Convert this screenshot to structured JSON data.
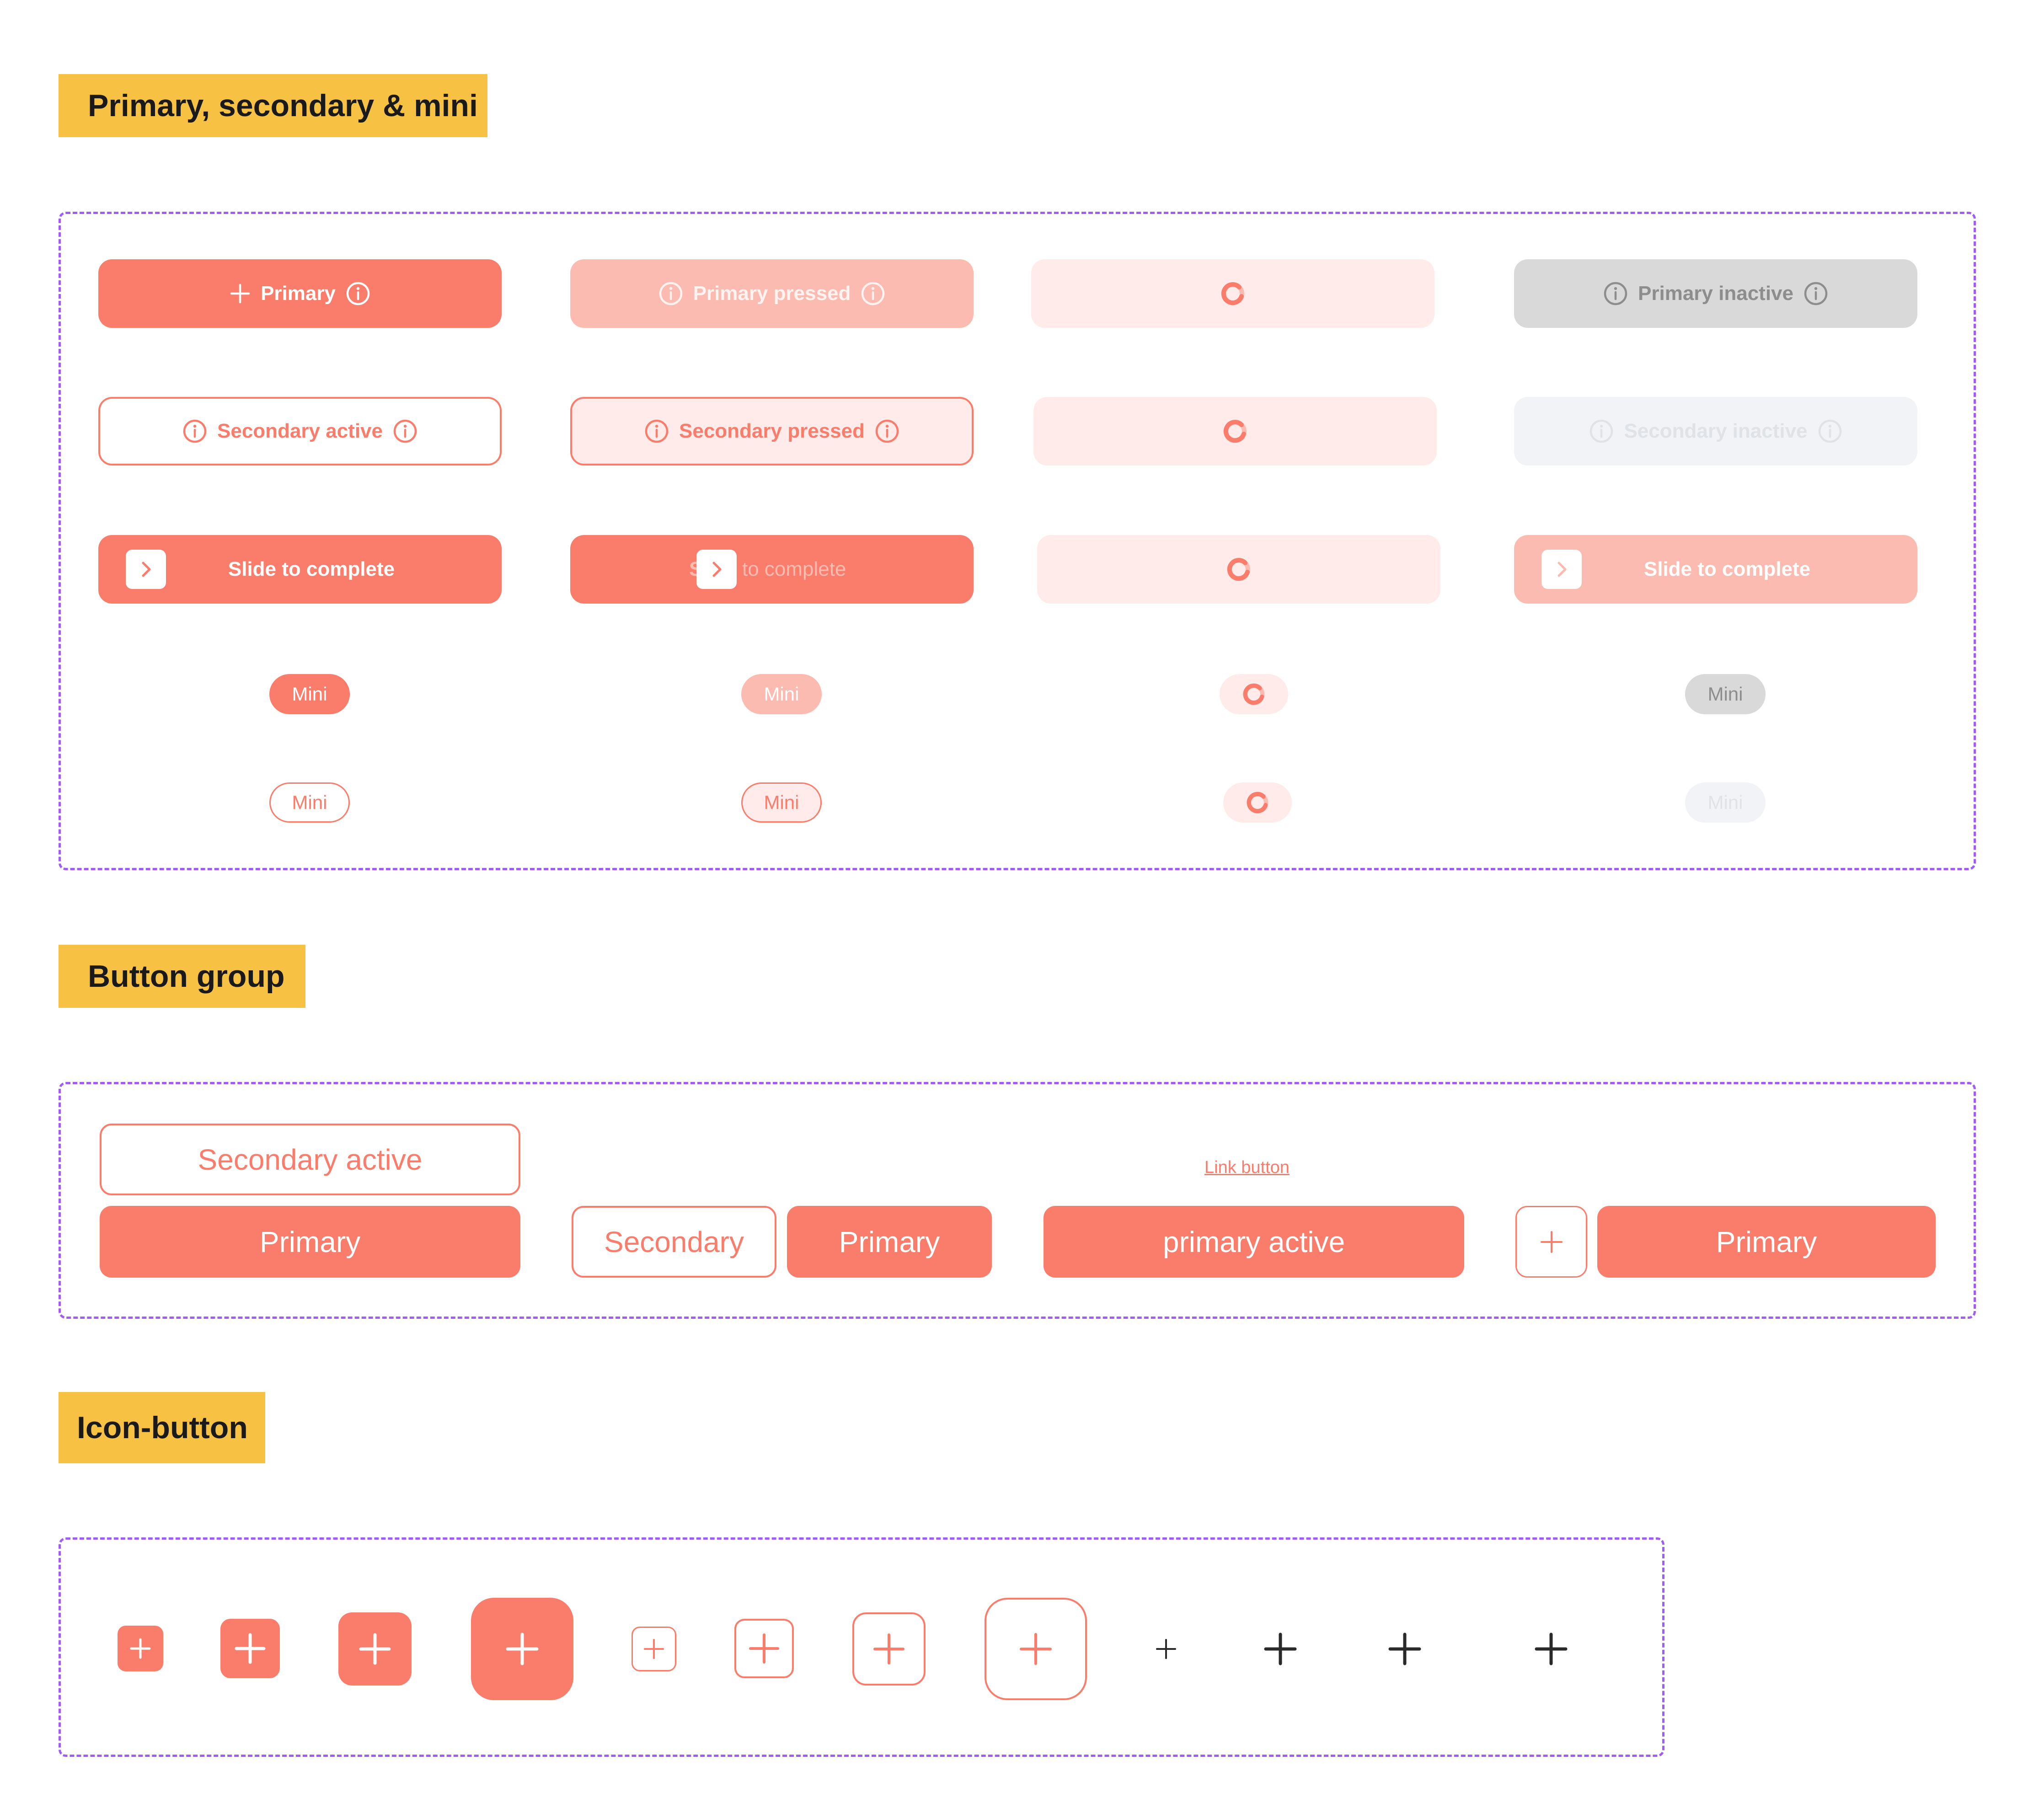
{
  "sections": {
    "primary_secondary_mini": "Primary, secondary & mini",
    "button_group": "Button group",
    "icon_button": "Icon-button"
  },
  "row_primary": {
    "active": "Primary",
    "pressed": "Primary pressed",
    "inactive": "Primary inactive"
  },
  "row_secondary": {
    "active": "Secondary active",
    "pressed": "Secondary pressed",
    "inactive": "Secondary inactive"
  },
  "row_slide": {
    "active": "Slide to complete",
    "dragging": "to complete",
    "dragging_hidden_char": "S",
    "inactive": "Slide to complete"
  },
  "row_mini": {
    "primary_active": "Mini",
    "primary_pressed": "Mini",
    "primary_inactive": "Mini",
    "secondary_active": "Mini",
    "secondary_pressed": "Mini",
    "secondary_inactive": "Mini"
  },
  "button_group": {
    "stacked_secondary": "Secondary active",
    "stacked_primary": "Primary",
    "pair_secondary": "Secondary",
    "pair_primary": "Primary",
    "link": "Link button",
    "single_primary": "primary active",
    "icon_pair_primary": "Primary"
  },
  "icons": {
    "plus": "plus-icon",
    "info": "info-icon",
    "chevron": "chevron-right-icon",
    "spinner": "spinner-icon"
  },
  "colors": {
    "accent": "#fa7c6b",
    "accent_pressed": "#fcbbb1",
    "accent_tint": "#ffecea",
    "inactive": "#d9d9d9",
    "label_bg": "#f7c244",
    "frame": "#a05cf5"
  }
}
